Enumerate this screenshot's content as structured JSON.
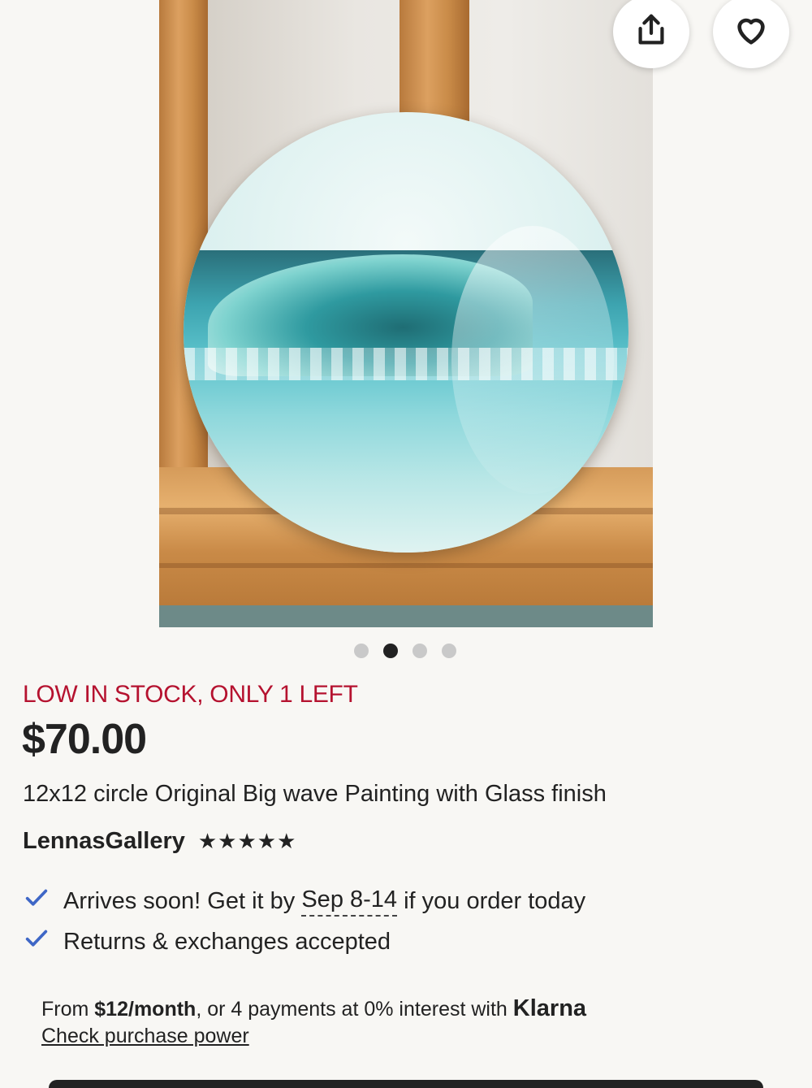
{
  "product": {
    "stock_note": "LOW IN STOCK, ONLY 1 LEFT",
    "price": "$70.00",
    "title": "12x12 circle Original Big wave Painting with Glass finish",
    "shop_name": "LennasGallery",
    "rating_stars": "★★★★★",
    "rating_value": 5
  },
  "gallery": {
    "image_count": 4,
    "active_index": 1,
    "share_icon": "share-icon",
    "favorite_icon": "heart-icon"
  },
  "perks": {
    "delivery_prefix": "Arrives soon! Get it by",
    "delivery_dates": "Sep 8-14",
    "delivery_suffix": "if you order today",
    "returns": "Returns & exchanges accepted"
  },
  "financing": {
    "prefix": "From",
    "monthly": "$12/month",
    "middle": ", or 4 payments at 0% interest with",
    "brand": "Klarna",
    "link": "Check purchase power"
  },
  "colors": {
    "stock_red": "#b5122f",
    "check_blue": "#3f67c6",
    "background": "#f8f7f4"
  }
}
